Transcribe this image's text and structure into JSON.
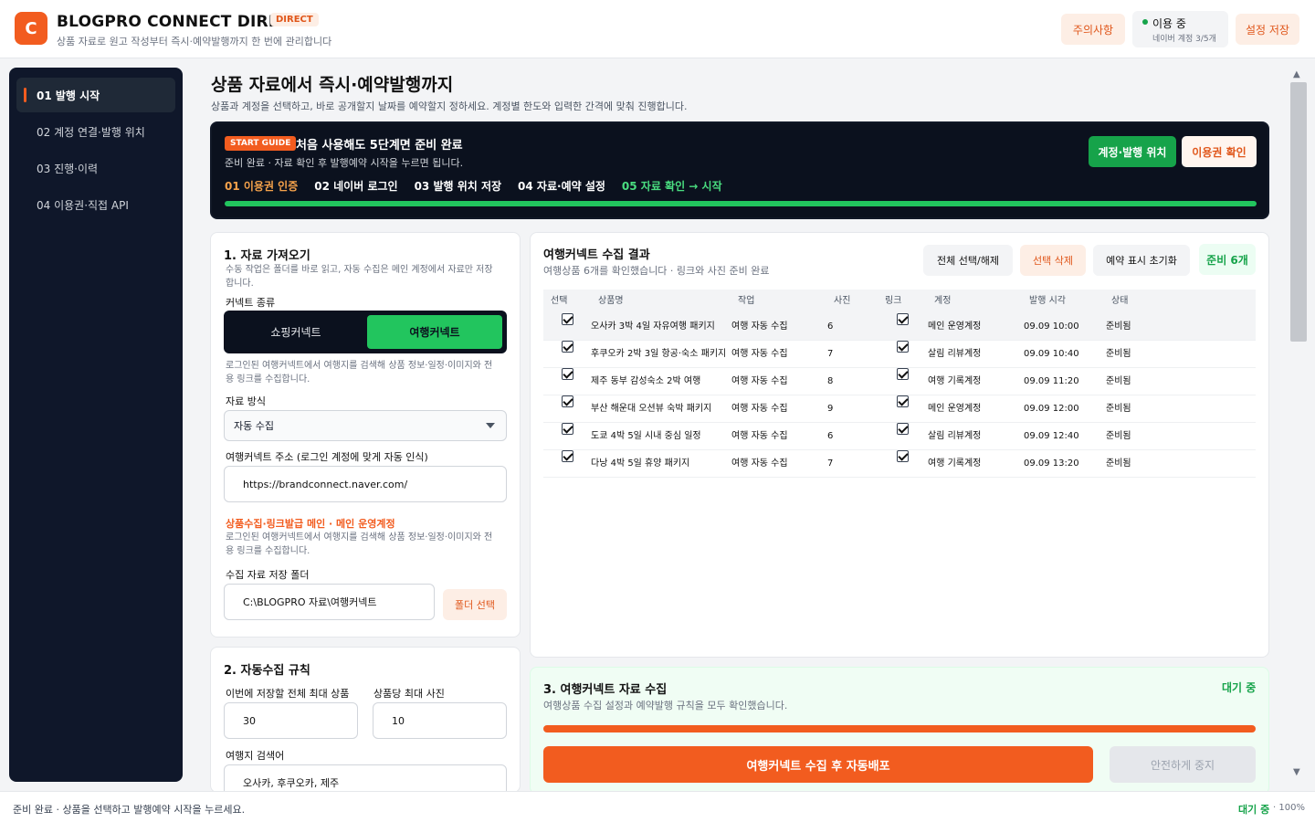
{
  "header": {
    "logo_letter": "C",
    "title": "BLOGPRO CONNECT DIRECT",
    "badge": "DIRECT",
    "subtitle": "상품 자료로 원고 작성부터 즉시·예약발행까지 한 번에 관리합니다",
    "notice_button": "주의사항",
    "status_label": "이용 중",
    "status_sub": "네이버 계정 3/5개",
    "save_button": "설정 저장"
  },
  "sidebar": {
    "items": [
      {
        "label": "01  발행 시작"
      },
      {
        "label": "02  계정 연결·발행 위치"
      },
      {
        "label": "03  진행·이력"
      },
      {
        "label": "04  이용권·직접 API"
      }
    ]
  },
  "main": {
    "title": "상품 자료에서 즉시·예약발행까지",
    "desc": "상품과 계정을 선택하고, 바로 공개할지 날짜를 예약할지 정하세요. 계정별 한도와 입력한 간격에 맞춰 진행합니다."
  },
  "guide": {
    "badge": "START GUIDE",
    "title": "처음 사용해도 5단계면 준비 완료",
    "sub": "준비 완료 · 자료 확인 후 발행예약 시작을 누르면 됩니다.",
    "steps": [
      "01 이용권 인증",
      "02 네이버 로그인",
      "03 발행 위치 저장",
      "04 자료·예약 설정",
      "05 자료 확인 → 시작"
    ],
    "btn_account": "계정·발행 위치",
    "btn_license": "이용권 확인"
  },
  "card1": {
    "title": "1. 자료 가져오기",
    "hint": "수동 작업은 폴더를 바로 읽고, 자동 수집은 메인 계정에서 자료만 저장합니다.",
    "type_label": "커넥트 종류",
    "type_options": [
      "쇼핑커넥트",
      "여행커넥트"
    ],
    "type_hint": "로그인된 여행커넥트에서 여행지를 검색해 상품 정보·일정·이미지와 전용 링크를 수집합니다.",
    "mode_label": "자료 방식",
    "mode_value": "자동 수집",
    "url_label": "여행커넥트 주소 (로그인 계정에 맞게 자동 인식)",
    "url_value": "https://brandconnect.naver.com/",
    "main_account_heading": "상품수집·링크발급 메인 · 메인 운영계정",
    "main_account_hint": "로그인된 여행커넥트에서 여행지를 검색해 상품 정보·일정·이미지와 전용 링크를 수집합니다.",
    "folder_label": "수집 자료 저장 폴더",
    "folder_value": "C:\\BLOGPRO 자료\\여행커넥트",
    "folder_button": "폴더 선택"
  },
  "card2": {
    "title": "2. 자동수집 규칙",
    "max_products_label": "이번에 저장할 전체 최대 상품",
    "max_products_value": "30",
    "max_photos_label": "상품당 최대 사진",
    "max_photos_value": "10",
    "keyword_label": "여행지 검색어",
    "keyword_value": "오사카, 후쿠오카, 제주"
  },
  "results": {
    "title": "여행커넥트 수집 결과",
    "sub": "여행상품 6개를 확인했습니다 · 링크와 사진 준비 완료",
    "btn_select_all": "전체 선택/해제",
    "btn_delete": "선택 삭제",
    "btn_reset": "예약 표시 초기화",
    "ready_badge": "준비 6개",
    "columns": [
      "선택",
      "상품명",
      "작업",
      "사진",
      "링크",
      "계정",
      "발행 시각",
      "상태"
    ],
    "rows": [
      {
        "name": "오사카 3박 4일 자유여행 패키지",
        "job": "여행 자동 수집",
        "photos": "6",
        "account": "메인 운영계정",
        "time": "09.09 10:00",
        "state": "준비됨"
      },
      {
        "name": "후쿠오카 2박 3일 항공·숙소 패키지",
        "job": "여행 자동 수집",
        "photos": "7",
        "account": "살림 리뷰계정",
        "time": "09.09 10:40",
        "state": "준비됨"
      },
      {
        "name": "제주 동부 감성숙소 2박 여행",
        "job": "여행 자동 수집",
        "photos": "8",
        "account": "여행 기록계정",
        "time": "09.09 11:20",
        "state": "준비됨"
      },
      {
        "name": "부산 해운대 오션뷰 숙박 패키지",
        "job": "여행 자동 수집",
        "photos": "9",
        "account": "메인 운영계정",
        "time": "09.09 12:00",
        "state": "준비됨"
      },
      {
        "name": "도쿄 4박 5일 시내 중심 일정",
        "job": "여행 자동 수집",
        "photos": "6",
        "account": "살림 리뷰계정",
        "time": "09.09 12:40",
        "state": "준비됨"
      },
      {
        "name": "다낭 4박 5일 휴양 패키지",
        "job": "여행 자동 수집",
        "photos": "7",
        "account": "여행 기록계정",
        "time": "09.09 13:20",
        "state": "준비됨"
      }
    ]
  },
  "card3": {
    "title": "3. 여행커넥트 자료 수집",
    "sub": "여행상품 수집 설정과 예약발행 규칙을 모두 확인했습니다.",
    "status": "대기 중",
    "progress_percent": 100,
    "run_button": "여행커넥트 수집 후 자동배포",
    "stop_button": "안전하게 중지"
  },
  "footer": {
    "text": "준비 완료 · 상품을 선택하고 발행예약 시작을 누르세요.",
    "status": "대기 중",
    "zoom": "· 100%"
  },
  "colors": {
    "accent": "#f25c1f",
    "success": "#16a34a",
    "dark": "#0b111e"
  }
}
